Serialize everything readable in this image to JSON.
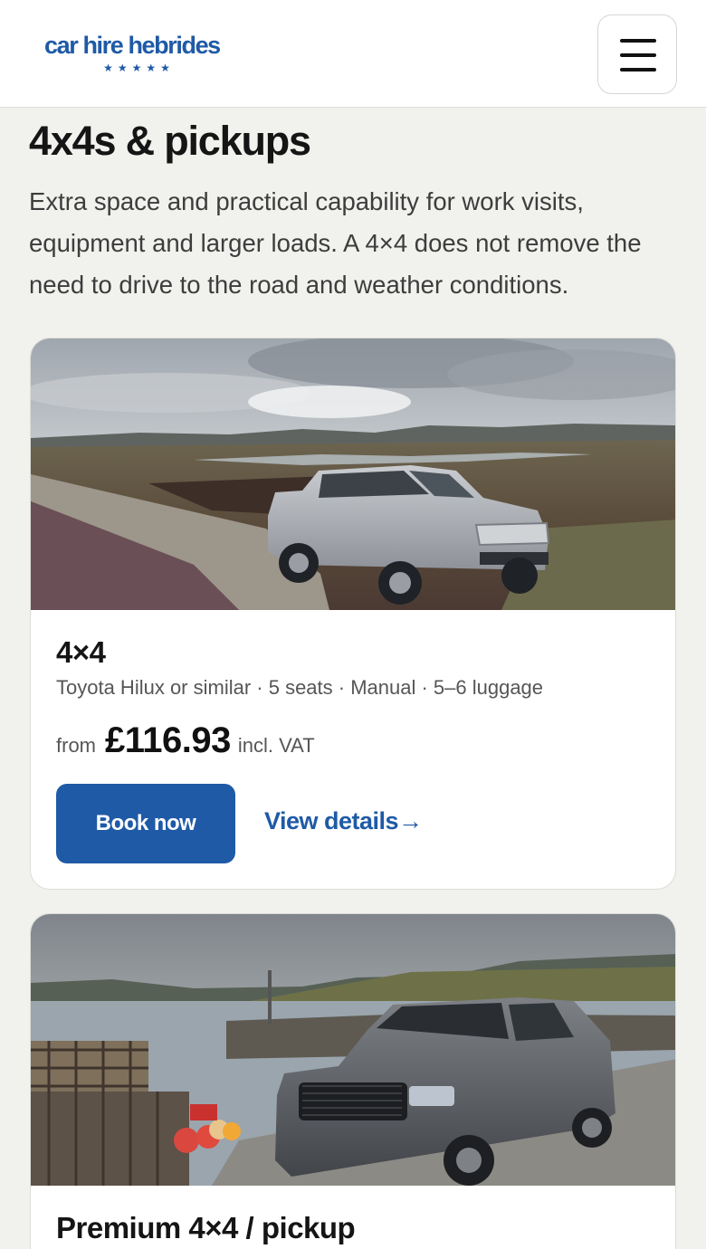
{
  "header": {
    "logo_text": "car hire hebrides",
    "logo_stars": "★★★★★",
    "menu_icon": "hamburger-menu-icon"
  },
  "section": {
    "title": "4x4s & pickups",
    "intro": "Extra space and practical capability for work visits, equipment and larger loads. A 4×4 does not remove the need to drive to the road and weather conditions."
  },
  "vehicles": [
    {
      "title": "4×4",
      "spec": "Toyota Hilux or similar · 5 seats · Manual · 5–6 luggage",
      "price_from": "from",
      "price": "£116.93",
      "price_vat": "incl. VAT",
      "book_label": "Book now",
      "details_label": "View details→",
      "photo": "silver-pickup-on-moorland-road"
    },
    {
      "title": "Premium 4×4 / pickup",
      "photo": "grey-pickup-at-harbour-with-lobster-pots"
    }
  ],
  "colors": {
    "brand": "#1f5aa6",
    "page_bg": "#f1f1ee",
    "card_bg": "#ffffff"
  }
}
